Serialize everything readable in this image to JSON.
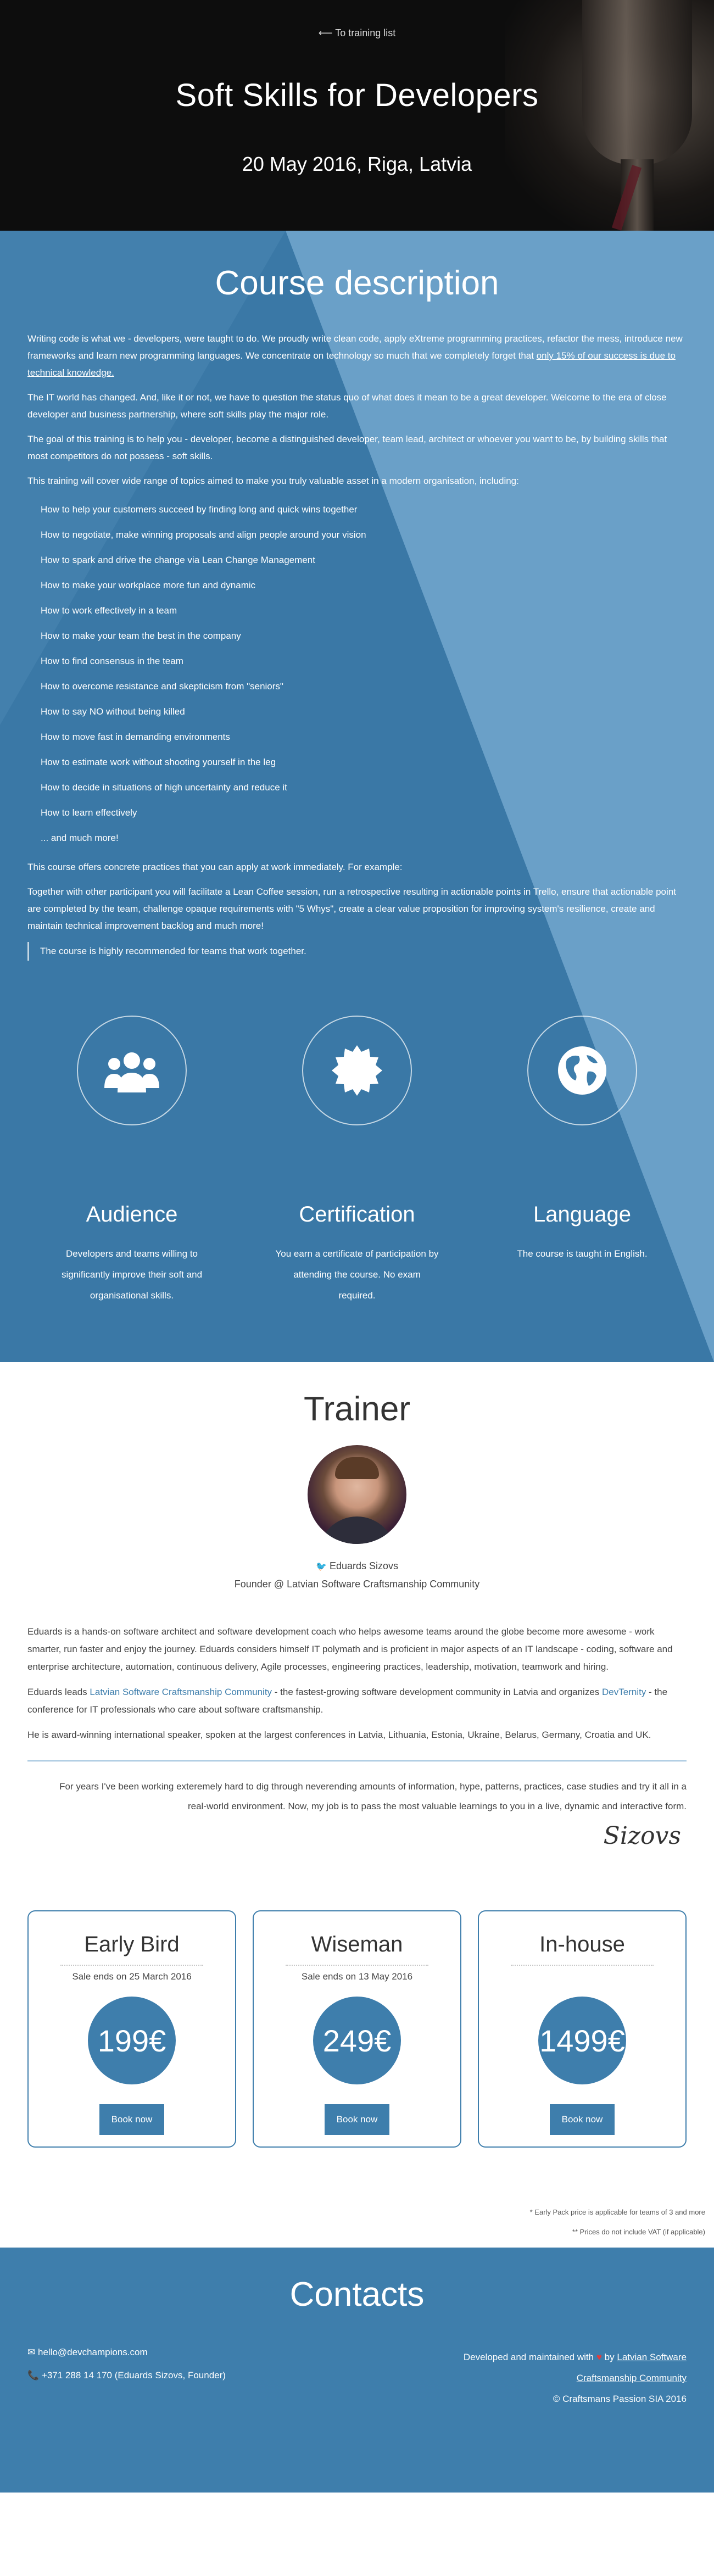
{
  "hero": {
    "back_link": "To training list",
    "title": "Soft Skills for Developers",
    "date": "20 May 2016, Riga, Latvia"
  },
  "course": {
    "heading": "Course description",
    "p1_prefix": "Writing code is what we - developers, were taught to do. We proudly write clean code, apply eXtreme programming practices, refactor the mess, introduce new frameworks and learn new programming languages. We concentrate on technology so much that we completely forget that ",
    "p1_underline": "only 15% of our success is due to technical knowledge.",
    "p2": "The IT world has changed. And, like it or not, we have to question the status quo of what does it mean to be a great developer. Welcome to the era of close developer and business partnership, where soft skills play the major role.",
    "p3": "The goal of this training is to help you - developer, become a distinguished developer, team lead, architect or whoever you want to be, by building skills that most competitors do not possess - soft skills.",
    "p4": "This training will cover wide range of topics aimed to make you truly valuable asset in a modern organisation, including:",
    "topics": [
      "How to help your customers succeed by finding long and quick wins together",
      "How to negotiate, make winning proposals and align people around your vision",
      "How to spark and drive the change via Lean Change Management",
      "How to make your workplace more fun and dynamic",
      "How to work effectively in a team",
      "How to make your team the best in the company",
      "How to find consensus in the team",
      "How to overcome resistance and skepticism from \"seniors\"",
      "How to say NO without being killed",
      "How to move fast in demanding environments",
      "How to estimate work without shooting yourself in the leg",
      "How to decide in situations of high uncertainty and reduce it",
      "How to learn effectively",
      "... and much more!"
    ],
    "p5": "This course offers concrete practices that you can apply at work immediately. For example:",
    "p6": "Together with other participant you will facilitate a Lean Coffee session, run a retrospective resulting in actionable points in Trello, ensure that actionable point are completed by the team, challenge opaque requirements with \"5 Whys\", create a clear value proposition for improving system's resilience, create and maintain technical improvement backlog and much more!",
    "quote": "The course is highly recommended for teams that work together.",
    "features": [
      {
        "title": "Audience",
        "text": "Developers and teams willing to significantly improve their soft and organisational skills.",
        "icon": "users-icon"
      },
      {
        "title": "Certification",
        "text": "You earn a certificate of participation by attending the course. No exam required.",
        "icon": "certificate-icon"
      },
      {
        "title": "Language",
        "text": "The course is taught in English.",
        "icon": "globe-icon"
      }
    ]
  },
  "trainer": {
    "heading": "Trainer",
    "name": "Eduards Sizovs",
    "role": "Founder @ Latvian Software Craftsmanship Community",
    "bio1": "Eduards is a hands-on software architect and software development coach who helps awesome teams around the globe become more awesome - work smarter, run faster and enjoy the journey. Eduards considers himself IT polymath and is proficient in major aspects of an IT landscape - coding, software and enterprise architecture, automation, continuous delivery, Agile processes, engineering practices, leadership, motivation, teamwork and hiring.",
    "bio2_a": "Eduards leads ",
    "bio2_link1": "Latvian Software Craftsmanship Community",
    "bio2_b": " - the fastest-growing software development community in Latvia and organizes ",
    "bio2_link2": "DevTernity",
    "bio2_c": " - the conference for IT professionals who care about software craftsmanship.",
    "bio3": "He is award-winning international speaker, spoken at the largest conferences in Latvia, Lithuania, Estonia, Ukraine, Belarus, Germany, Croatia and UK.",
    "quote": "For years I've been working exteremely hard to dig through neverending amounts of information, hype, patterns, practices, case studies and try it all in a real-world environment. Now, my job is to pass the most valuable learnings to you in a live, dynamic and interactive form.",
    "signature": "Sizovs"
  },
  "pricing": [
    {
      "title": "Early Bird",
      "ends": "Sale ends on 25 March 2016",
      "price": "199€",
      "button": "Book now"
    },
    {
      "title": "Wiseman",
      "ends": "Sale ends on 13 May 2016",
      "price": "249€",
      "button": "Book now"
    },
    {
      "title": "In-house",
      "ends": "",
      "price": "1499€",
      "button": "Book now"
    }
  ],
  "notes": {
    "n1": "* Early Pack price is applicable for teams of 3 and more",
    "n2": "** Prices do not include VAT (if applicable)"
  },
  "contacts": {
    "heading": "Contacts",
    "email": "hello@devchampions.com",
    "phone": "+371 288 14 170 (Eduards Sizovs, Founder)",
    "dev_prefix": "Developed and maintained with",
    "dev_by": "by",
    "dev_link": "Latvian Software Craftsmanship Community",
    "copyright": "© Craftsmans Passion SIA 2016"
  },
  "colors": {
    "accent": "#3e7eac",
    "heart": "#e23b3b"
  }
}
